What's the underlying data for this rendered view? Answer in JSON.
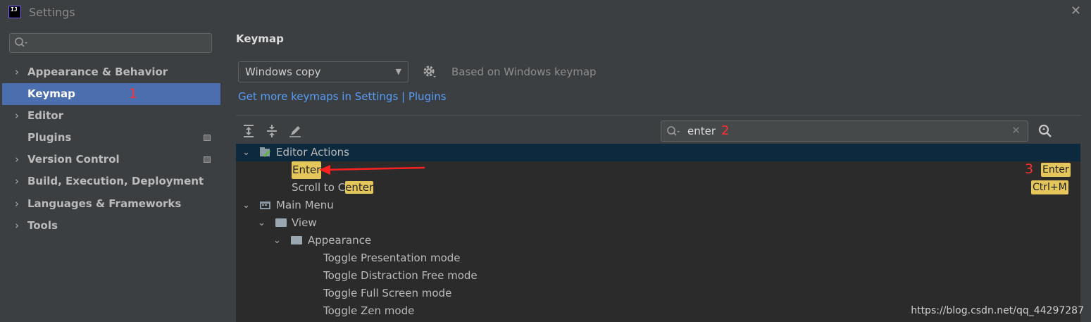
{
  "window": {
    "title": "Settings",
    "app_icon_text": "IJ"
  },
  "sidebar": {
    "search_placeholder": "",
    "items": [
      {
        "label": "Appearance & Behavior",
        "expandable": true
      },
      {
        "label": "Keymap",
        "selected": true,
        "annotation": "1"
      },
      {
        "label": "Editor",
        "expandable": true
      },
      {
        "label": "Plugins"
      },
      {
        "label": "Version Control",
        "expandable": true
      },
      {
        "label": "Build, Execution, Deployment",
        "expandable": true
      },
      {
        "label": "Languages & Frameworks",
        "expandable": true
      },
      {
        "label": "Tools",
        "expandable": true
      }
    ]
  },
  "main": {
    "heading": "Keymap",
    "keymap_value": "Windows copy",
    "based_on": "Based on Windows keymap",
    "get_more_link": "Get more keymaps in Settings | Plugins",
    "filter": {
      "value": "enter",
      "annotation": "2"
    },
    "tree": {
      "editor_actions": "Editor Actions",
      "enter_action": "Enter",
      "enter_annotation": "3",
      "enter_shortcut": "Enter",
      "scroll_prefix": "Scroll to C",
      "scroll_highlight": "enter",
      "scroll_shortcut": "Ctrl+M",
      "main_menu": "Main Menu",
      "view": "View",
      "appearance": "Appearance",
      "toggles": [
        "Toggle Presentation mode",
        "Toggle Distraction Free mode",
        "Toggle Full Screen mode",
        "Toggle Zen mode"
      ]
    }
  },
  "watermark": "https://blog.csdn.net/qq_44297287",
  "colors": {
    "selection": "#4b6eaf",
    "highlight": "#e4c65b",
    "link": "#589df6",
    "annotation": "#ff3030"
  }
}
